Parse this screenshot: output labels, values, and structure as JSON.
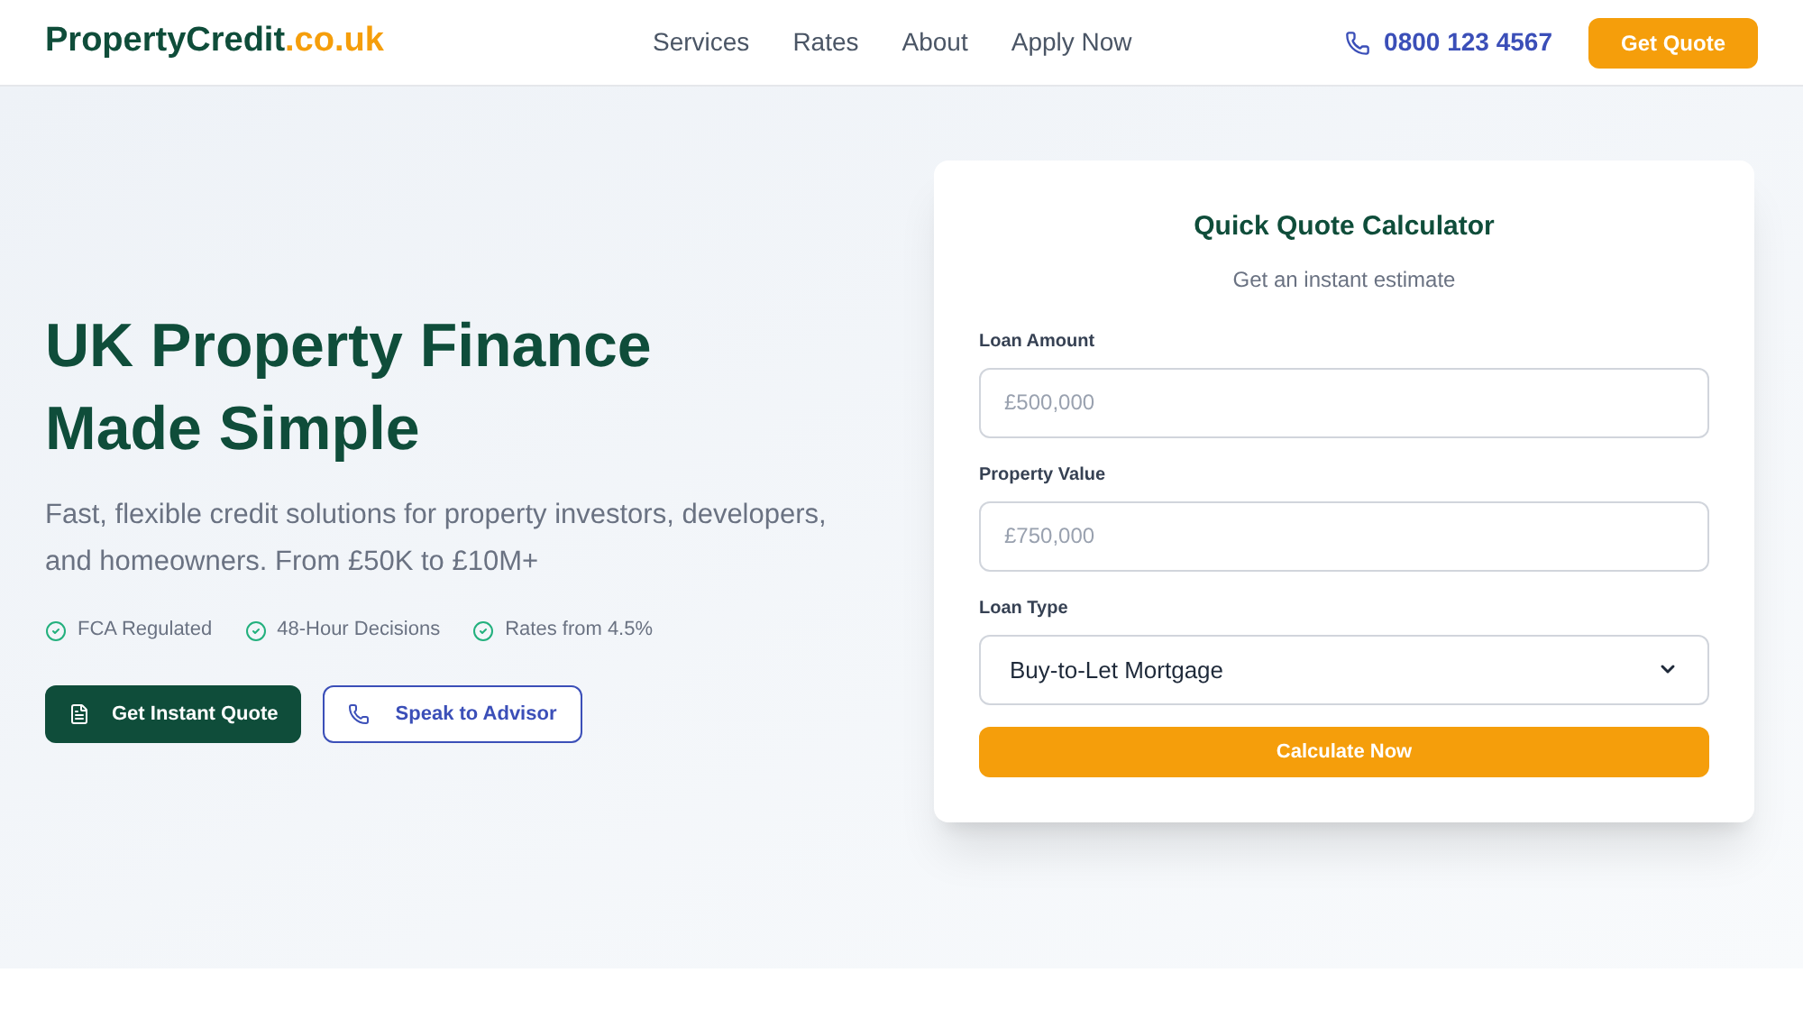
{
  "header": {
    "logo": {
      "name": "PropertyCredit",
      "suffix": ".co.uk"
    },
    "nav": [
      {
        "label": "Services"
      },
      {
        "label": "Rates"
      },
      {
        "label": "About"
      },
      {
        "label": "Apply Now"
      }
    ],
    "phone": "0800 123 4567",
    "cta": "Get Quote"
  },
  "hero": {
    "title_lines": [
      "UK Property Finance",
      "Made Simple"
    ],
    "subtitle": "Fast, flexible credit solutions for property investors, developers, and homeowners. From £50K to £10M+",
    "features": [
      "FCA Regulated",
      "48-Hour Decisions",
      "Rates from 4.5%"
    ],
    "buttons": [
      {
        "kind": "primary",
        "label": "Get Instant Quote"
      },
      {
        "kind": "secondary",
        "label": "Speak to Advisor"
      }
    ]
  },
  "calculator": {
    "title": "Quick Quote Calculator",
    "subtitle": "Get an instant estimate",
    "fields": [
      {
        "kind": "input",
        "label": "Loan Amount",
        "placeholder": "£500,000"
      },
      {
        "kind": "input",
        "label": "Property Value",
        "placeholder": "£750,000"
      },
      {
        "kind": "select",
        "label": "Loan Type",
        "value": "Buy-to-Let Mortgage"
      }
    ],
    "submit": "Calculate Now"
  }
}
